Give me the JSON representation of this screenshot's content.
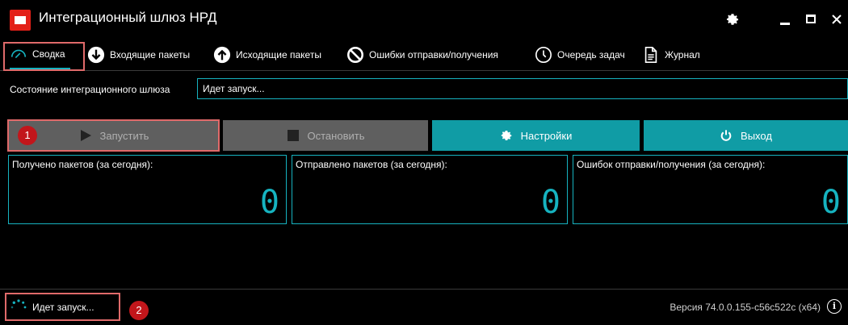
{
  "window": {
    "title": "Интеграционный шлюз НРД"
  },
  "tabs": [
    {
      "label": "Сводка",
      "icon": "gauge-icon"
    },
    {
      "label": "Входящие пакеты",
      "icon": "arrow-down-circle-icon"
    },
    {
      "label": "Исходящие пакеты",
      "icon": "arrow-up-circle-icon"
    },
    {
      "label": "Ошибки отправки/получения",
      "icon": "forbidden-icon"
    },
    {
      "label": "Очередь задач",
      "icon": "clock-icon"
    },
    {
      "label": "Журнал",
      "icon": "document-icon"
    }
  ],
  "status": {
    "label": "Состояние интеграционного шлюза",
    "value": "Идет запуск..."
  },
  "actions": {
    "start": "Запустить",
    "stop": "Остановить",
    "settings": "Настройки",
    "exit": "Выход"
  },
  "counters": [
    {
      "label": "Получено пакетов (за сегодня):",
      "value": "0"
    },
    {
      "label": "Отправлено пакетов (за сегодня):",
      "value": "0"
    },
    {
      "label": "Ошибок отправки/получения (за сегодня):",
      "value": "0"
    }
  ],
  "footer": {
    "status": "Идет запуск...",
    "version": "Версия 74.0.0.155-c56c522c (x64)"
  },
  "markers": [
    "1",
    "2"
  ],
  "colors": {
    "accent": "#16b3c0",
    "button": "#109ca5",
    "disabled": "#5f5f5f",
    "brand": "#e32018",
    "highlight": "#e06a6a",
    "marker": "#c2161b"
  }
}
